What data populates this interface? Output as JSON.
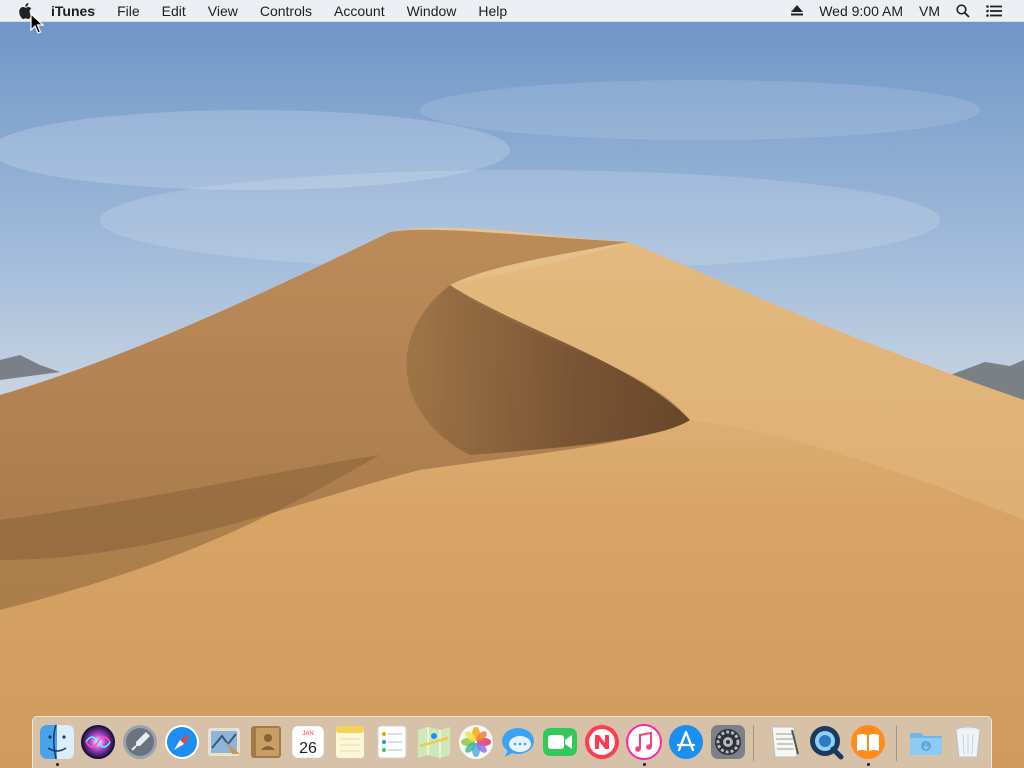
{
  "menubar": {
    "apple_icon": "apple-logo-icon",
    "app_name": "iTunes",
    "menus": [
      "File",
      "Edit",
      "View",
      "Controls",
      "Account",
      "Window",
      "Help"
    ],
    "status": {
      "eject_icon": "eject-icon",
      "clock": "Wed 9:00 AM",
      "user": "VM",
      "spotlight_icon": "search-icon",
      "notification_icon": "notification-center-icon"
    }
  },
  "dock": {
    "apps": [
      {
        "name": "Finder",
        "icon": "finder-icon",
        "running": true
      },
      {
        "name": "Siri",
        "icon": "siri-icon",
        "running": false
      },
      {
        "name": "Launchpad",
        "icon": "launchpad-icon",
        "running": false
      },
      {
        "name": "Safari",
        "icon": "safari-icon",
        "running": false
      },
      {
        "name": "Mail",
        "icon": "mail-icon",
        "running": false
      },
      {
        "name": "Contacts",
        "icon": "contacts-icon",
        "running": false
      },
      {
        "name": "Calendar",
        "icon": "calendar-icon",
        "running": false,
        "month": "JAN",
        "day": "26"
      },
      {
        "name": "Notes",
        "icon": "notes-icon",
        "running": false
      },
      {
        "name": "Reminders",
        "icon": "reminders-icon",
        "running": false
      },
      {
        "name": "Maps",
        "icon": "maps-icon",
        "running": false
      },
      {
        "name": "Photos",
        "icon": "photos-icon",
        "running": false
      },
      {
        "name": "Messages",
        "icon": "messages-icon",
        "running": false
      },
      {
        "name": "FaceTime",
        "icon": "facetime-icon",
        "running": false
      },
      {
        "name": "News",
        "icon": "news-icon",
        "running": false
      },
      {
        "name": "iTunes",
        "icon": "itunes-icon",
        "running": true
      },
      {
        "name": "App Store",
        "icon": "app-store-icon",
        "running": false
      },
      {
        "name": "System Preferences",
        "icon": "system-preferences-icon",
        "running": false
      },
      {
        "name": "TextEdit",
        "icon": "textedit-icon",
        "running": false
      },
      {
        "name": "QuickTime Player",
        "icon": "quicktime-icon",
        "running": false
      },
      {
        "name": "Books",
        "icon": "books-icon",
        "running": true
      },
      {
        "name": "Downloads",
        "icon": "downloads-folder-icon",
        "running": false
      },
      {
        "name": "Trash",
        "icon": "trash-icon",
        "running": false
      }
    ]
  }
}
